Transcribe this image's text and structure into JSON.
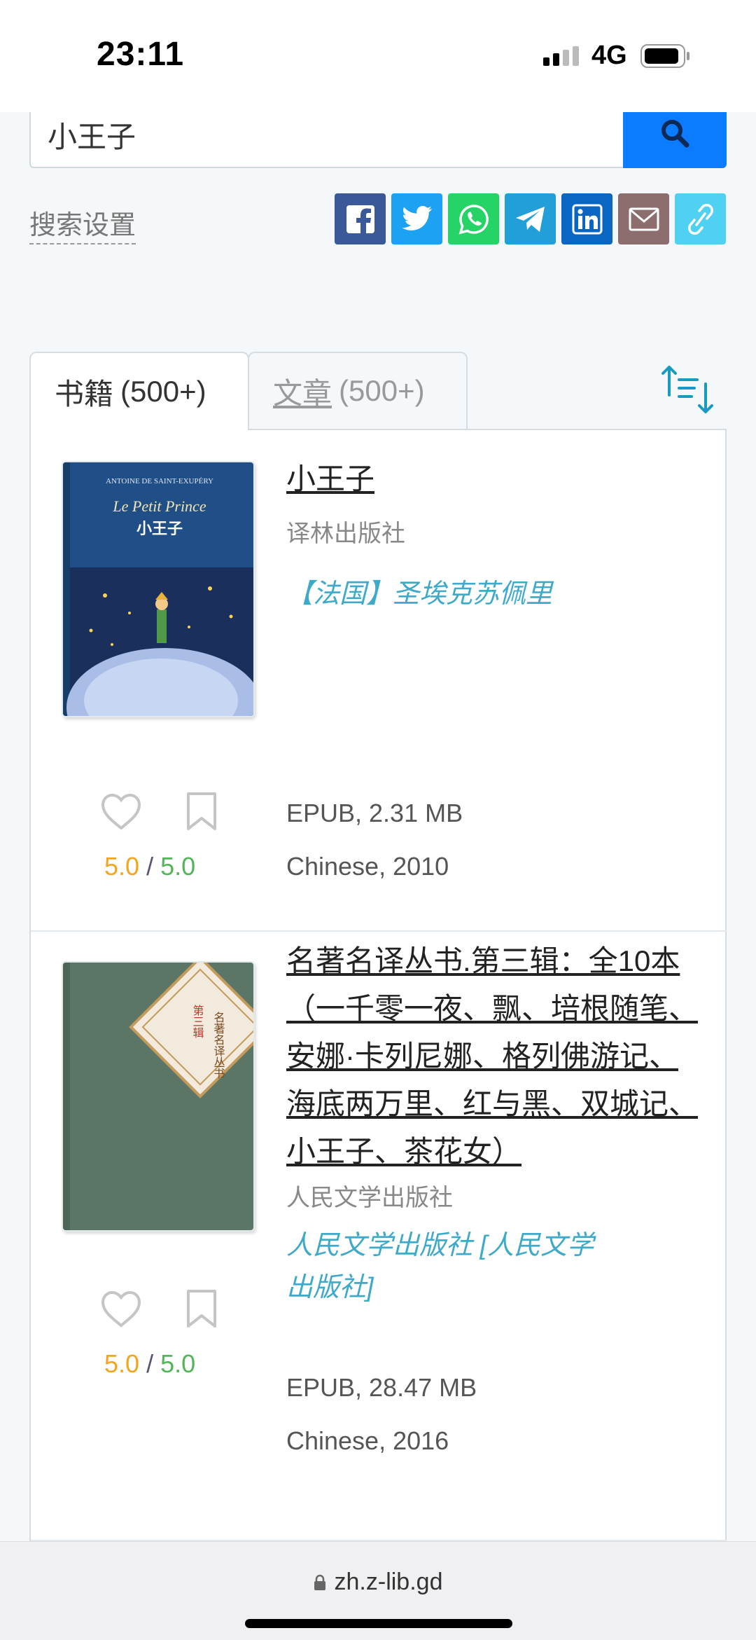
{
  "status_bar": {
    "time": "23:11",
    "network": "4G"
  },
  "search": {
    "query": "小王子"
  },
  "search_settings_label": "搜索设置",
  "share_buttons": [
    {
      "name": "facebook",
      "color": "#3b5998"
    },
    {
      "name": "twitter",
      "color": "#1da1f2"
    },
    {
      "name": "whatsapp",
      "color": "#25d366"
    },
    {
      "name": "telegram",
      "color": "#229ed9"
    },
    {
      "name": "linkedin",
      "color": "#0a66c2"
    },
    {
      "name": "email",
      "color": "#8d6e6e"
    },
    {
      "name": "link",
      "color": "#4fd2f2"
    }
  ],
  "tabs": {
    "books": {
      "label": "书籍",
      "count": "(500+)"
    },
    "articles": {
      "label": "文章",
      "count": "(500+)"
    }
  },
  "books": [
    {
      "title": "小王子",
      "publisher": "译林出版社",
      "author": "【法国】圣埃克苏佩里",
      "format": "EPUB, 2.31 MB",
      "language_year": "Chinese, 2010",
      "rating_a": "5.0",
      "rating_sep": "/",
      "rating_b": "5.0",
      "cover_title_fr": "Le Petit Prince",
      "cover_title_zh": "小王子"
    },
    {
      "title": "名著名译丛书.第三辑：全10本（一千零一夜、飘、培根随笔、安娜·卡列尼娜、格列佛游记、海底两万里、红与黑、双城记、小王子、茶花女）",
      "publisher": "人民文学出版社",
      "author": "人民文学出版社 [人民文学出版社]",
      "format": "EPUB, 28.47 MB",
      "language_year": "Chinese, 2016",
      "rating_a": "5.0",
      "rating_sep": "/",
      "rating_b": "5.0",
      "cover_title_zh": "名著名译丛书",
      "cover_sub": "第三辑"
    }
  ],
  "bottom_bar": {
    "url": "zh.z-lib.gd"
  }
}
